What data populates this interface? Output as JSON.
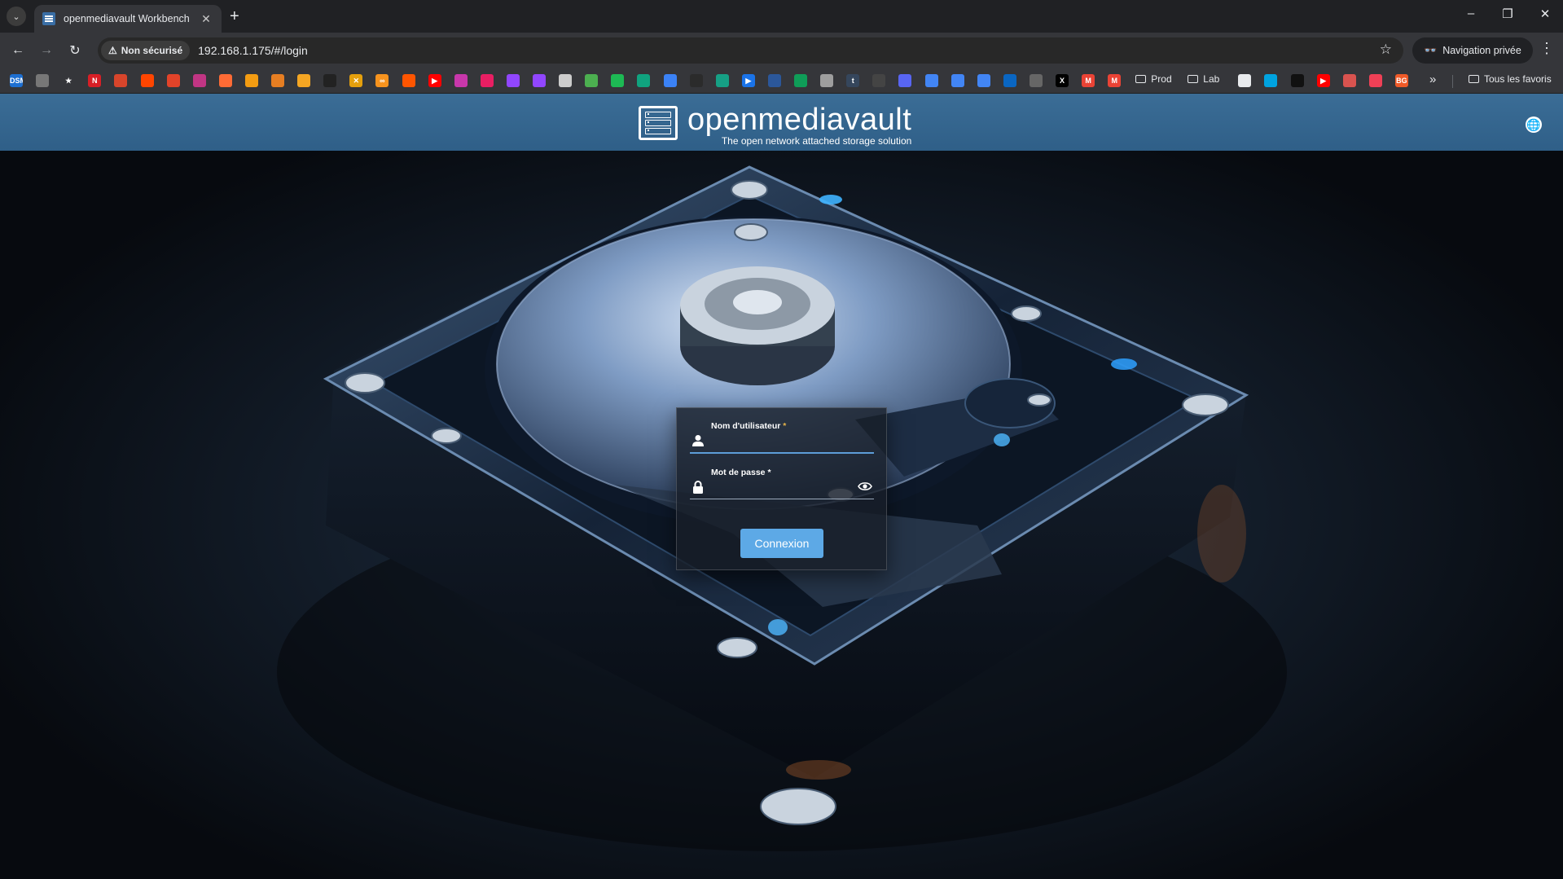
{
  "browser": {
    "tab": {
      "title": "openmediavault Workbench",
      "favicon": "omv-favicon"
    },
    "new_tab_label": "+",
    "window_controls": {
      "minimize": "–",
      "restore": "❐",
      "close": "✕"
    },
    "address": {
      "security_label": "Non sécurisé",
      "url": "192.168.1.175/#/login"
    },
    "private_label": "Navigation privée",
    "bookmarks": [
      {
        "label": "DSM",
        "color": "#1d6fd1"
      },
      {
        "label": "",
        "color": "#777777"
      },
      {
        "label": "★",
        "color": "#35363a"
      },
      {
        "label": "N",
        "color": "#d81f26"
      },
      {
        "label": "",
        "color": "#d8452b"
      },
      {
        "label": "",
        "color": "#ff4500"
      },
      {
        "label": "",
        "color": "#e24329"
      },
      {
        "label": "",
        "color": "#c13584"
      },
      {
        "label": "",
        "color": "#ff6b35"
      },
      {
        "label": "",
        "color": "#f39c12"
      },
      {
        "label": "",
        "color": "#e67e22"
      },
      {
        "label": "",
        "color": "#f5a623"
      },
      {
        "label": "",
        "color": "#222222"
      },
      {
        "label": "✕",
        "color": "#e5a00d"
      },
      {
        "label": "∞",
        "color": "#f7931e"
      },
      {
        "label": "",
        "color": "#ff5500"
      },
      {
        "label": "▶",
        "color": "#ff0000"
      },
      {
        "label": "",
        "color": "#c837ab"
      },
      {
        "label": "",
        "color": "#e91e63"
      },
      {
        "label": "",
        "color": "#9146ff"
      },
      {
        "label": "",
        "color": "#9146ff"
      },
      {
        "label": "",
        "color": "#cccccc"
      },
      {
        "label": "",
        "color": "#4caf50"
      },
      {
        "label": "",
        "color": "#1db954"
      },
      {
        "label": "",
        "color": "#10a37f"
      },
      {
        "label": "",
        "color": "#3b82f6"
      },
      {
        "label": "",
        "color": "#2b2b2b"
      },
      {
        "label": "",
        "color": "#16a085"
      },
      {
        "label": "▶",
        "color": "#1a73e8"
      },
      {
        "label": "",
        "color": "#2b579a"
      },
      {
        "label": "",
        "color": "#0f9d58"
      },
      {
        "label": "",
        "color": "#9e9e9e"
      },
      {
        "label": "t",
        "color": "#35465c"
      },
      {
        "label": "",
        "color": "#444444"
      },
      {
        "label": "",
        "color": "#5865f2"
      },
      {
        "label": "",
        "color": "#4285f4"
      },
      {
        "label": "",
        "color": "#4285f4"
      },
      {
        "label": "",
        "color": "#4285f4"
      },
      {
        "label": "",
        "color": "#0a66c2"
      },
      {
        "label": "",
        "color": "#666666"
      },
      {
        "label": "X",
        "color": "#000000"
      },
      {
        "label": "M",
        "color": "#ea4335"
      },
      {
        "label": "M",
        "color": "#ea4335"
      }
    ],
    "bookmark_folders": [
      "Prod",
      "Lab"
    ],
    "bookmarks_after": [
      {
        "label": "",
        "color": "#e8eaed"
      },
      {
        "label": "",
        "color": "#00a3e0"
      },
      {
        "label": "",
        "color": "#111111"
      },
      {
        "label": "▶",
        "color": "#ff0000"
      },
      {
        "label": "",
        "color": "#d9534f"
      },
      {
        "label": "",
        "color": "#ef4056"
      },
      {
        "label": "BG",
        "color": "#f05a28"
      }
    ],
    "bookmarks_more": "»",
    "all_bookmarks_label": "Tous les favoris"
  },
  "app": {
    "name": "openmediavault",
    "tagline": "The open network attached storage solution",
    "accent": "#5da9e6"
  },
  "login": {
    "username": {
      "label": "Nom d'utilisateur",
      "required_mark": "*",
      "value": ""
    },
    "password": {
      "label": "Mot de passe",
      "required_mark": "*",
      "value": ""
    },
    "submit_label": "Connexion"
  }
}
